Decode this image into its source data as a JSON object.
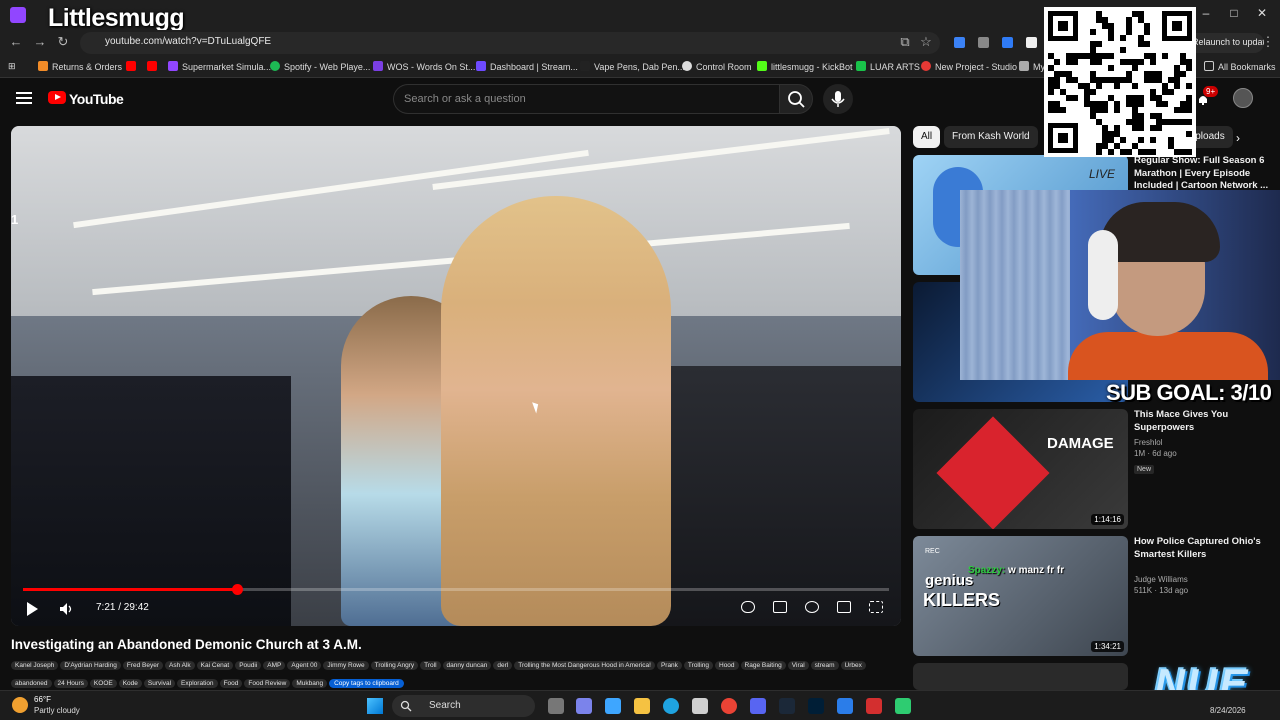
{
  "overlay": {
    "stream_title": "Littlesmugg",
    "sub_goal": "SUB GOAL: 3/10",
    "chat_user": "Spazzy:",
    "chat_message": "w manz fr fr",
    "brand_logo": "NUE"
  },
  "browser": {
    "url": "youtube.com/watch?v=DTuLualgQFE",
    "update_label": "Relaunch to update",
    "bookmarks": [
      "Returns & Orders",
      "Supermarket Simula...",
      "Spotify - Web Playe...",
      "WOS - Words On St...",
      "Dashboard | Stream...",
      "Vape Pens, Dab Pen...",
      "Control Room",
      "littlesmugg - KickBot",
      "LUAR ARTS",
      "New Project - Studio",
      "My"
    ],
    "all_bookmarks": "All Bookmarks"
  },
  "youtube": {
    "logo_text": "YouTube",
    "search_placeholder": "Search or ask a question",
    "notification_count": "9+",
    "player": {
      "time": "7:21 / 29:42",
      "progress_fraction": 0.2476
    },
    "video_title": "Investigating an Abandoned Demonic Church at 3 A.M.",
    "tags": [
      "Kanel Joseph",
      "D'Aydrian Harding",
      "Fred Beyer",
      "Ash Alk",
      "Kai Cenat",
      "Poudii",
      "AMP",
      "Agent 00",
      "Jimmy Rowe",
      "Trolling Angry",
      "Troll",
      "danny duncan",
      "derl",
      "Trolling the Most Dangerous Hood in America!",
      "Prank",
      "Trolling",
      "Hood",
      "Rage Baiting",
      "Viral",
      "stream",
      "Urbex",
      "abandoned",
      "24 Hours",
      "KOOE",
      "Kode",
      "Survival",
      "Exploration",
      "Food",
      "Food Review",
      "Mukbang"
    ],
    "copy_tags_label": "Copy tags to clipboard",
    "chips": [
      "All",
      "From Kash World",
      "Uploads"
    ],
    "sidebar": [
      {
        "title": "Regular Show: Full Season 6 Marathon | Every Episode Included | Cartoon Network ...",
        "channel": "",
        "meta": "",
        "duration": "",
        "live_label": "LIVE"
      },
      {
        "title": "This Mace Gives You Superpowers",
        "channel": "Freshlol",
        "meta": "1M · 6d ago",
        "badge": "New",
        "duration": "1:14:16",
        "thumb_text": "DAMAGE"
      },
      {
        "title": "How Police Captured Ohio's Smartest Killers",
        "channel": "Judge Williams",
        "meta": "511K · 13d ago",
        "duration": "1:34:21",
        "thumb_text_1": "genius",
        "thumb_text_2": "KILLERS",
        "rec_label": "REC"
      }
    ]
  },
  "taskbar": {
    "temperature": "66°F",
    "weather": "Partly cloudy",
    "search_label": "Search",
    "date": "8/24/2026"
  }
}
